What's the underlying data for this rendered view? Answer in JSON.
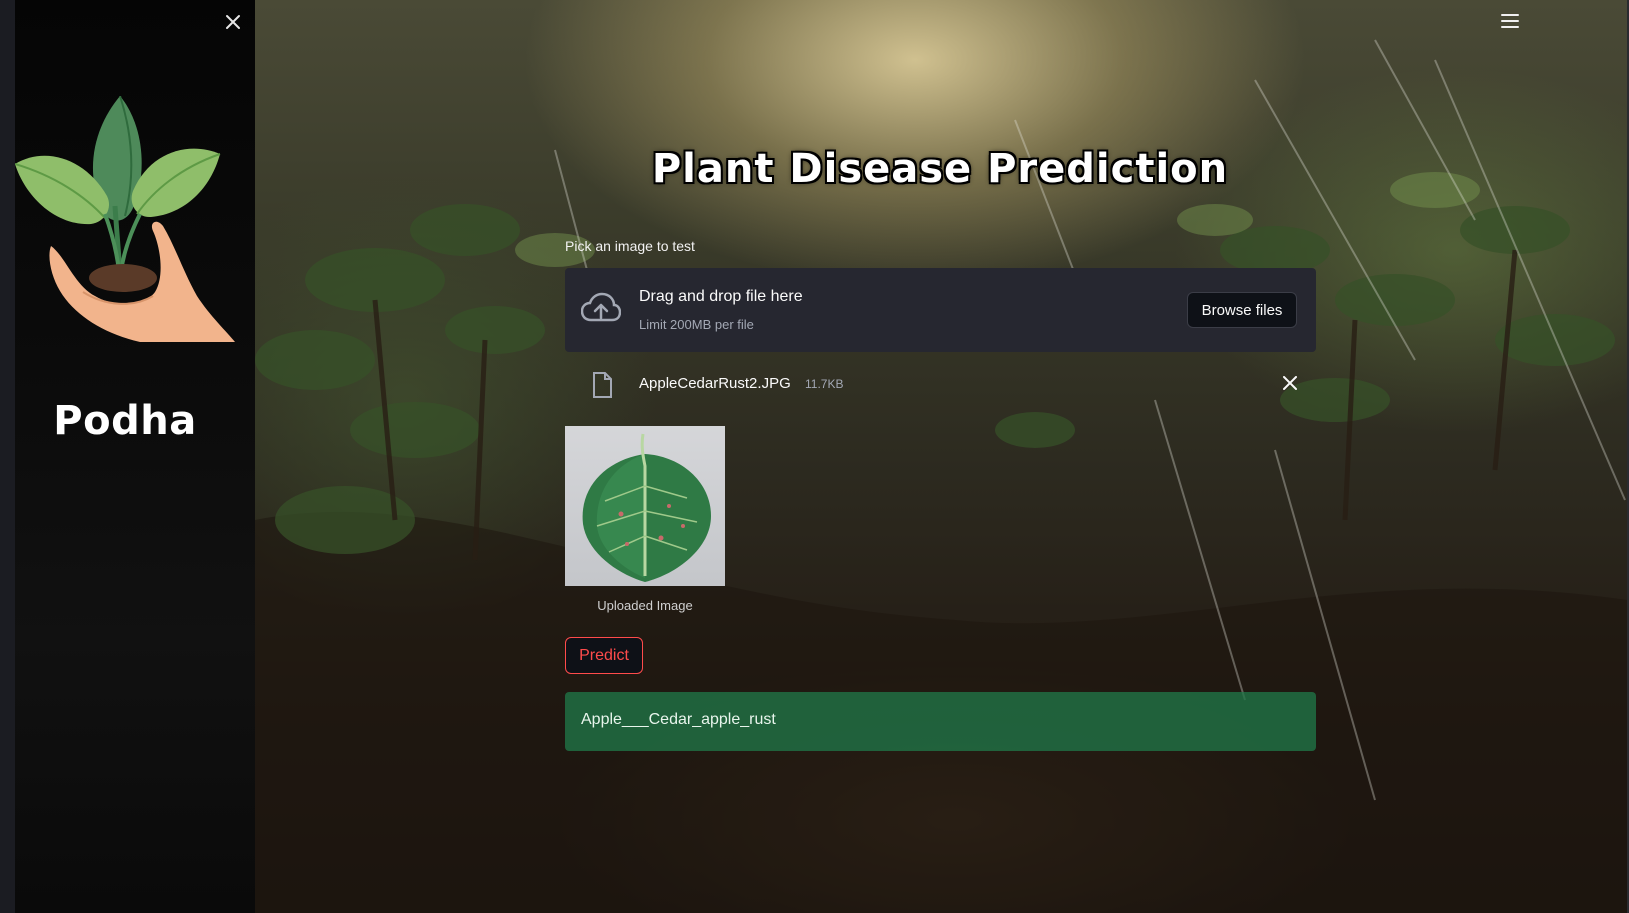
{
  "sidebar": {
    "brand_name": "Podha",
    "close_icon": "close-icon",
    "logo_icon": "plant-in-hand-logo"
  },
  "header": {
    "menu_icon": "hamburger-menu-icon"
  },
  "main": {
    "title": "Plant Disease Prediction",
    "uploader": {
      "label": "Pick an image to test",
      "drop_title": "Drag and drop file here",
      "drop_limit": "Limit 200MB per file",
      "browse_label": "Browse files",
      "upload_icon": "cloud-upload-icon"
    },
    "file": {
      "name": "AppleCedarRust2.JPG",
      "size": "11.7KB",
      "file_icon": "file-icon",
      "remove_icon": "close-icon"
    },
    "image_caption": "Uploaded Image",
    "predict_label": "Predict",
    "result": "Apple___Cedar_apple_rust"
  },
  "colors": {
    "accent": "#ff4b4b",
    "success": "#207648",
    "panel": "#262730",
    "sidebar_bg": "#0b0b0b"
  }
}
